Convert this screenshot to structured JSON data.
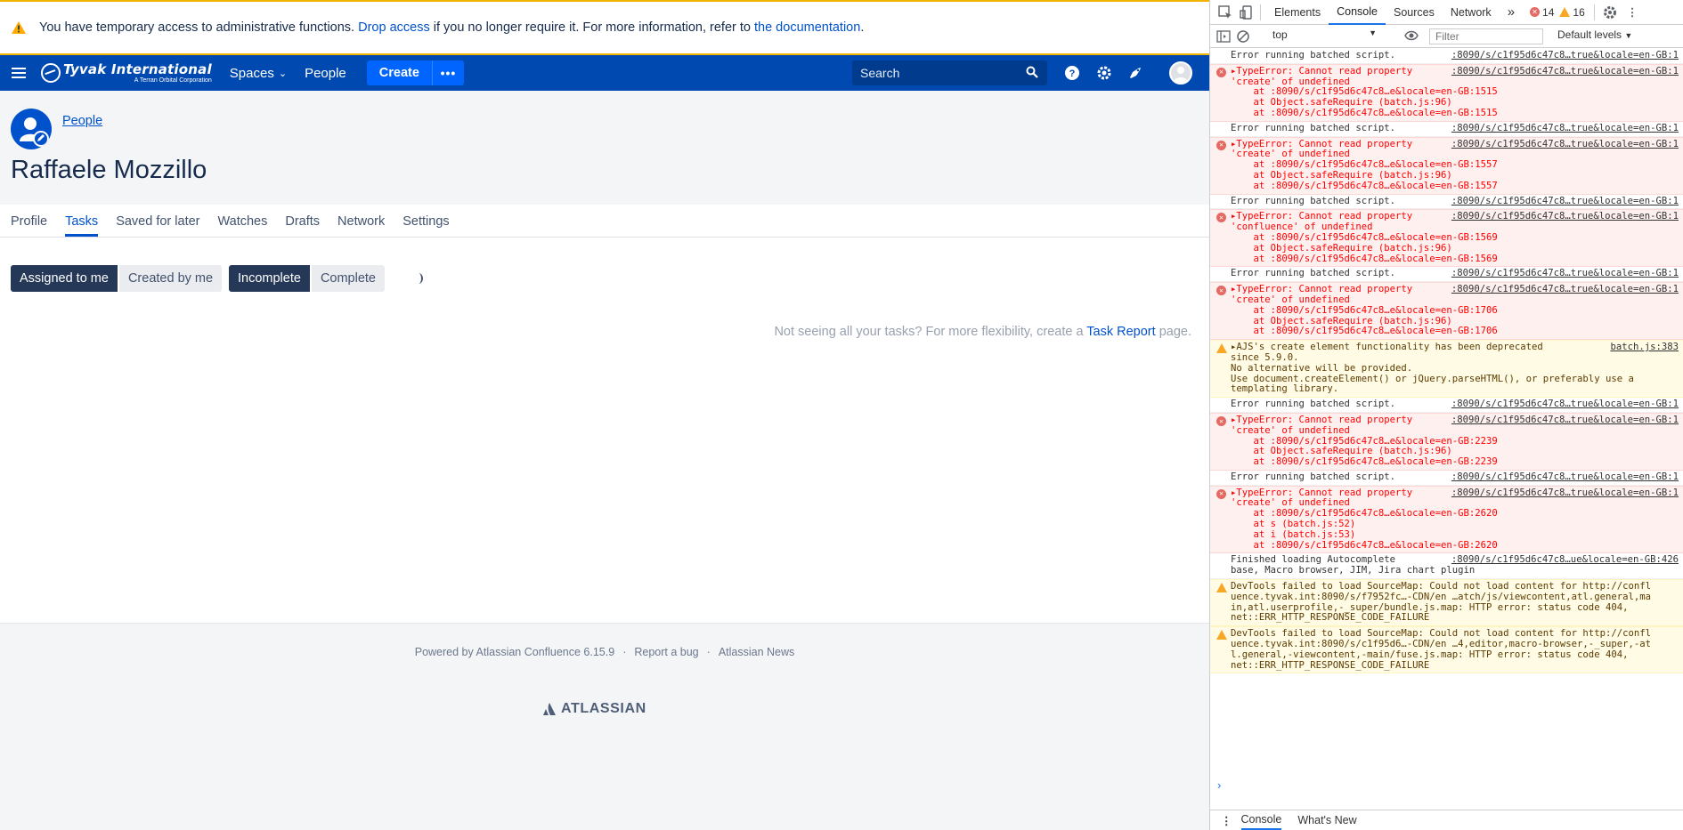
{
  "banner": {
    "text_before": "You have temporary access to administrative functions.",
    "drop_link": "Drop access",
    "text_middle": "if you no longer require it. For more information, refer to",
    "doc_link": "the documentation",
    "text_end": "."
  },
  "header": {
    "brand": "Tyvak International",
    "brand_tagline": "A Terran Orbital Corporation",
    "spaces": "Spaces",
    "people": "People",
    "create": "Create",
    "more": "•••",
    "search_placeholder": "Search"
  },
  "profile": {
    "breadcrumb": "People",
    "name": "Raffaele Mozzillo",
    "tabs": [
      "Profile",
      "Tasks",
      "Saved for later",
      "Watches",
      "Drafts",
      "Network",
      "Settings"
    ],
    "active_tab": "Tasks"
  },
  "tasks": {
    "assigned_to_me": "Assigned to me",
    "created_by_me": "Created by me",
    "incomplete": "Incomplete",
    "complete": "Complete",
    "hint_before": "Not seeing all your tasks? For more flexibility, create a",
    "hint_link": "Task Report",
    "hint_after": "page."
  },
  "footer": {
    "powered": "Powered by Atlassian Confluence 6.15.9",
    "report_bug": "Report a bug",
    "news": "Atlassian News",
    "sep": "·",
    "atlassian": "ATLASSIAN"
  },
  "devtools": {
    "tabs": [
      "Elements",
      "Console",
      "Sources",
      "Network"
    ],
    "active_tab": "Console",
    "overflow": "»",
    "error_count": "14",
    "warning_count": "16",
    "context": "top",
    "filter_placeholder": "Filter",
    "levels": "Default levels",
    "messages": [
      {
        "type": "log",
        "text": "Error running batched script.",
        "src": ":8090/s/c1f95d6c47c8…true&locale=en-GB:1"
      },
      {
        "type": "error",
        "text": "▸TypeError: Cannot read property\n'create' of undefined\n    at :8090/s/c1f95d6c47c8…e&locale=en-GB:1515\n    at Object.safeRequire (batch.js:96)\n    at :8090/s/c1f95d6c47c8…e&locale=en-GB:1515",
        "src": ":8090/s/c1f95d6c47c8…true&locale=en-GB:1"
      },
      {
        "type": "log",
        "text": "Error running batched script.",
        "src": ":8090/s/c1f95d6c47c8…true&locale=en-GB:1"
      },
      {
        "type": "error",
        "text": "▸TypeError: Cannot read property\n'create' of undefined\n    at :8090/s/c1f95d6c47c8…e&locale=en-GB:1557\n    at Object.safeRequire (batch.js:96)\n    at :8090/s/c1f95d6c47c8…e&locale=en-GB:1557",
        "src": ":8090/s/c1f95d6c47c8…true&locale=en-GB:1"
      },
      {
        "type": "log",
        "text": "Error running batched script.",
        "src": ":8090/s/c1f95d6c47c8…true&locale=en-GB:1"
      },
      {
        "type": "error",
        "text": "▸TypeError: Cannot read property\n'confluence' of undefined\n    at :8090/s/c1f95d6c47c8…e&locale=en-GB:1569\n    at Object.safeRequire (batch.js:96)\n    at :8090/s/c1f95d6c47c8…e&locale=en-GB:1569",
        "src": ":8090/s/c1f95d6c47c8…true&locale=en-GB:1"
      },
      {
        "type": "log",
        "text": "Error running batched script.",
        "src": ":8090/s/c1f95d6c47c8…true&locale=en-GB:1"
      },
      {
        "type": "error",
        "text": "▸TypeError: Cannot read property\n'create' of undefined\n    at :8090/s/c1f95d6c47c8…e&locale=en-GB:1706\n    at Object.safeRequire (batch.js:96)\n    at :8090/s/c1f95d6c47c8…e&locale=en-GB:1706",
        "src": ":8090/s/c1f95d6c47c8…true&locale=en-GB:1"
      },
      {
        "type": "warn",
        "text": "▸AJS's create element functionality has been deprecated\nsince 5.9.0.\nNo alternative will be provided.\nUse document.createElement() or jQuery.parseHTML(), or preferably use a\ntemplating library.",
        "src": "batch.js:383"
      },
      {
        "type": "log",
        "text": "Error running batched script.",
        "src": ":8090/s/c1f95d6c47c8…true&locale=en-GB:1"
      },
      {
        "type": "error",
        "text": "▸TypeError: Cannot read property\n'create' of undefined\n    at :8090/s/c1f95d6c47c8…e&locale=en-GB:2239\n    at Object.safeRequire (batch.js:96)\n    at :8090/s/c1f95d6c47c8…e&locale=en-GB:2239",
        "src": ":8090/s/c1f95d6c47c8…true&locale=en-GB:1"
      },
      {
        "type": "log",
        "text": "Error running batched script.",
        "src": ":8090/s/c1f95d6c47c8…true&locale=en-GB:1"
      },
      {
        "type": "error",
        "text": "▸TypeError: Cannot read property\n'create' of undefined\n    at :8090/s/c1f95d6c47c8…e&locale=en-GB:2620\n    at s (batch.js:52)\n    at i (batch.js:53)\n    at :8090/s/c1f95d6c47c8…e&locale=en-GB:2620",
        "src": ":8090/s/c1f95d6c47c8…true&locale=en-GB:1"
      },
      {
        "type": "log",
        "text": "Finished loading Autocomplete\nbase, Macro browser, JIM, Jira chart plugin",
        "src": ":8090/s/c1f95d6c47c8…ue&locale=en-GB:426"
      },
      {
        "type": "warn",
        "text": "DevTools failed to load SourceMap: Could not load content for http://confl\nuence.tyvak.int:8090/s/f7952fc…-CDN/en …atch/js/viewcontent,atl.general,ma\nin,atl.userprofile,-_super/bundle.js.map: HTTP error: status code 404,\nnet::ERR_HTTP_RESPONSE_CODE_FAILURE",
        "src": ""
      },
      {
        "type": "warn",
        "text": "DevTools failed to load SourceMap: Could not load content for http://confl\nuence.tyvak.int:8090/s/c1f95d6…-CDN/en …4,editor,macro-browser,-_super,-at\nl.general,-viewcontent,-main/fuse.js.map: HTTP error: status code 404,\nnet::ERR_HTTP_RESPONSE_CODE_FAILURE",
        "src": ""
      }
    ],
    "prompt": "›",
    "drawer_tabs": [
      "Console",
      "What's New"
    ],
    "drawer_menu": "⋮"
  },
  "colors": {
    "header": "#0049b0",
    "create": "#0065ff",
    "link": "#0052cc",
    "selected_toggle": "#253858",
    "banner_border": "#f1b500",
    "error_bg": "#fff0f0",
    "warn_bg": "#fffbe5"
  },
  "icons": {
    "banner": "warning-icon",
    "header": [
      "menu-icon",
      "search-icon",
      "help-icon",
      "settings-icon",
      "notifications-icon",
      "user-avatar"
    ]
  }
}
